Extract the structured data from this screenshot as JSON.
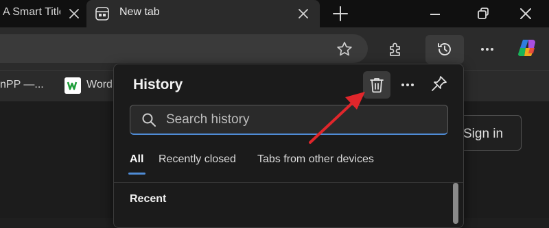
{
  "tabs": {
    "inactive_title": "A Smart Title",
    "active_title": "New tab"
  },
  "favorites": {
    "item1": "nPP —...",
    "item2": "Word"
  },
  "page": {
    "sign_in_label": "Sign in"
  },
  "history": {
    "title": "History",
    "search_placeholder": "Search history",
    "tabs": [
      "All",
      "Recently closed",
      "Tabs from other devices"
    ],
    "active_tab": "All",
    "section_label": "Recent"
  },
  "colors": {
    "accent": "#4f8cd6",
    "annotation_arrow": "#e0262b"
  },
  "icons": [
    "close-icon",
    "new-tab-plus-icon",
    "minimize-icon",
    "restore-icon",
    "star-icon",
    "extensions-icon",
    "history-icon",
    "more-icon",
    "copilot-icon",
    "trash-icon",
    "pin-icon",
    "search-icon"
  ]
}
